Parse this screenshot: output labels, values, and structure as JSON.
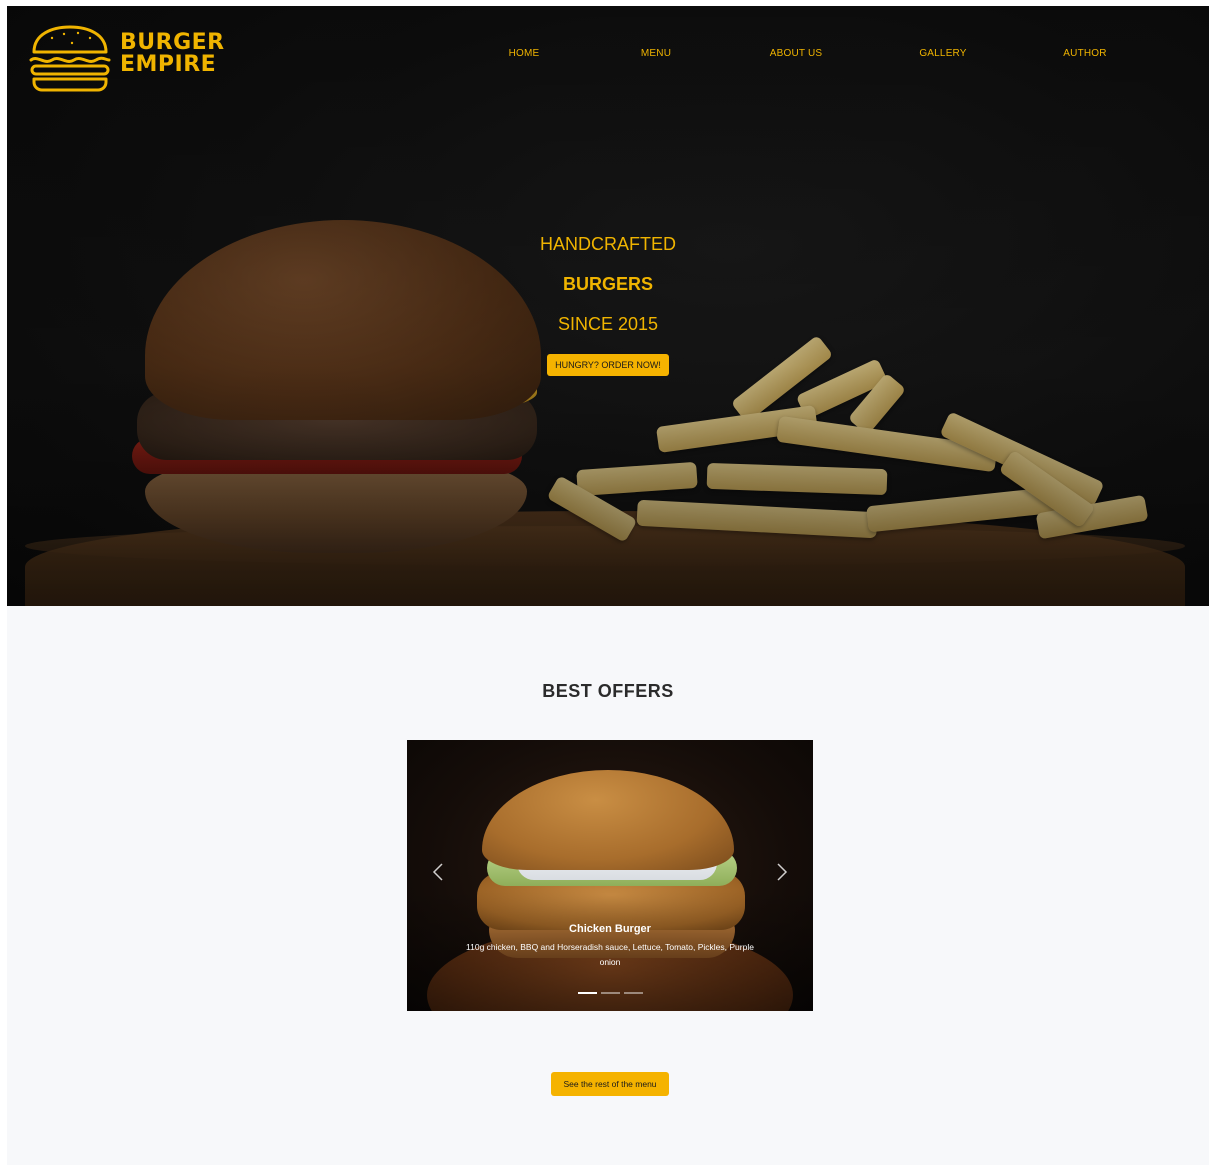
{
  "logo": {
    "line1": "BURGER",
    "line2": "EMPIRE"
  },
  "nav": [
    {
      "label": "HOME"
    },
    {
      "label": "MENU"
    },
    {
      "label": "ABOUT US"
    },
    {
      "label": "GALLERY"
    },
    {
      "label": "AUTHOR"
    }
  ],
  "hero": {
    "line1": "HANDCRAFTED",
    "line2": "BURGERS",
    "line3": "SINCE 2015",
    "cta": "HUNGRY? ORDER NOW!"
  },
  "offers": {
    "title": "BEST OFFERS",
    "slide": {
      "title": "Chicken Burger",
      "description": "110g chicken, BBQ and Horseradish sauce, Lettuce, Tomato, Pickles, Purple onion"
    },
    "slide_count": 3,
    "active_slide": 1,
    "menu_button": "See the rest of the menu"
  },
  "colors": {
    "accent": "#f5b300",
    "hero_bg": "#121212",
    "section_bg": "#f7f8fa"
  },
  "icons": {
    "logo": "burger-icon",
    "prev": "chevron-left-icon",
    "next": "chevron-right-icon"
  }
}
